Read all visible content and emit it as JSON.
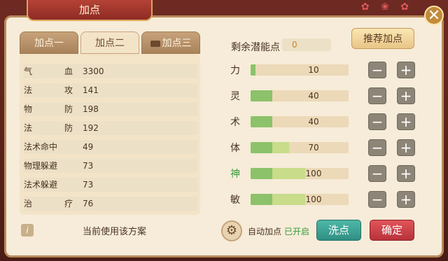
{
  "window": {
    "title": "加点"
  },
  "icons": {
    "close": "close-icon",
    "gear": "gear-icon",
    "info": "info-icon",
    "lock": "lock-icon"
  },
  "tabs": [
    {
      "label": "加点一"
    },
    {
      "label": "加点二"
    },
    {
      "label": "加点三"
    }
  ],
  "stats": [
    {
      "name": [
        "气",
        "血"
      ],
      "value": "3300"
    },
    {
      "name": [
        "法",
        "攻"
      ],
      "value": "141"
    },
    {
      "name": [
        "物",
        "防"
      ],
      "value": "198"
    },
    {
      "name": [
        "法",
        "防"
      ],
      "value": "192"
    },
    {
      "name": [
        "法术命中"
      ],
      "value": "49"
    },
    {
      "name": [
        "物理躲避"
      ],
      "value": "73"
    },
    {
      "name": [
        "法术躲避"
      ],
      "value": "73"
    },
    {
      "name": [
        "治",
        "疗"
      ],
      "value": "76"
    }
  ],
  "scheme_text": "当前使用该方案",
  "potential": {
    "label": "剩余潜能点",
    "value": "0"
  },
  "recommend_label": "推荐加点",
  "attributes": [
    {
      "label": "力",
      "value": "10",
      "base": 0.05,
      "add": 0.05,
      "color": "#4a3322"
    },
    {
      "label": "灵",
      "value": "40",
      "base": 0.22,
      "add": 0.22,
      "color": "#4a3322"
    },
    {
      "label": "术",
      "value": "40",
      "base": 0.22,
      "add": 0.22,
      "color": "#4a3322"
    },
    {
      "label": "体",
      "value": "70",
      "base": 0.22,
      "add": 0.39,
      "color": "#4a3322"
    },
    {
      "label": "神",
      "value": "100",
      "base": 0.22,
      "add": 0.56,
      "color": "#3a9a3a"
    },
    {
      "label": "敏",
      "value": "100",
      "base": 0.22,
      "add": 0.56,
      "color": "#4a3322"
    }
  ],
  "buttons": {
    "minus": "−",
    "plus": "+",
    "close": "✕",
    "gear": "⚙",
    "info": "i"
  },
  "auto": {
    "label": "自动加点",
    "status": "已开启"
  },
  "wash_label": "洗点",
  "confirm_label": "确定",
  "colors": {
    "bar_base": "#8cc26a",
    "bar_add": "#c8dc8a",
    "accent_red": "#b8323a",
    "accent_teal": "#2f8f82"
  }
}
